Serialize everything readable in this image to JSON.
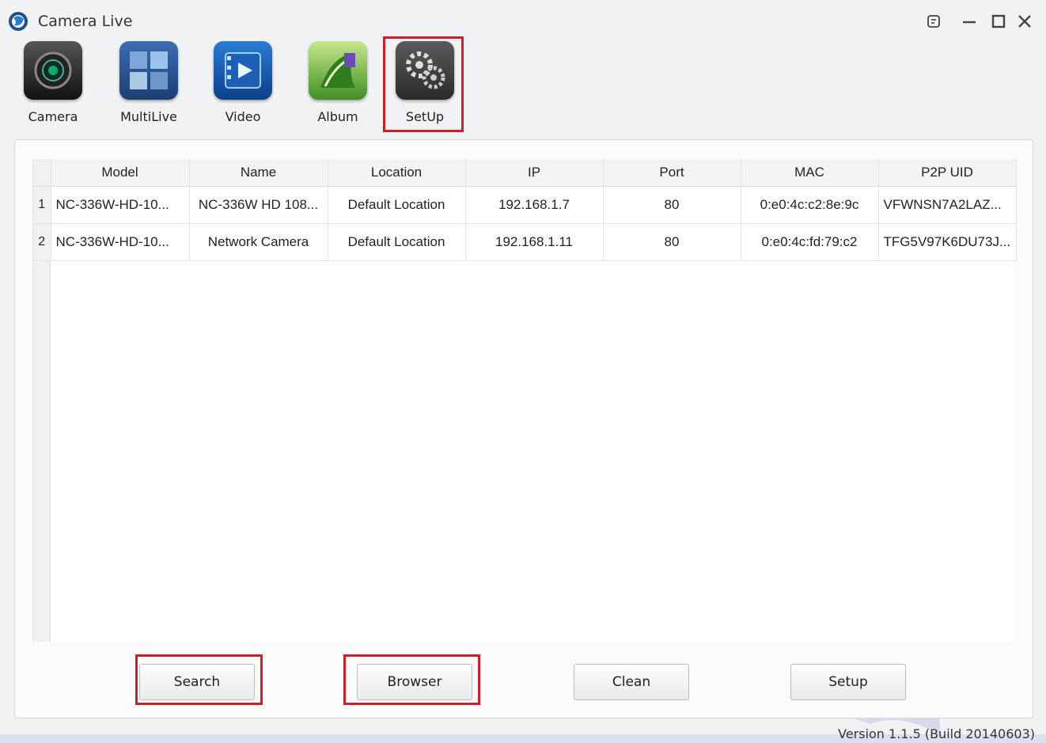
{
  "app": {
    "title": "Camera Live",
    "version": "Version 1.1.5 (Build 20140603)"
  },
  "toolbar": {
    "items": [
      {
        "label": "Camera",
        "icon": "camera-icon"
      },
      {
        "label": "MultiLive",
        "icon": "multilive-icon"
      },
      {
        "label": "Video",
        "icon": "video-icon"
      },
      {
        "label": "Album",
        "icon": "album-icon"
      },
      {
        "label": "SetUp",
        "icon": "gear-icon"
      }
    ]
  },
  "table": {
    "columns": [
      "Model",
      "Name",
      "Location",
      "IP",
      "Port",
      "MAC",
      "P2P UID"
    ],
    "rows": [
      {
        "index": "1",
        "model": "NC-336W-HD-10...",
        "name": "NC-336W HD 108...",
        "location": "Default Location",
        "ip": "192.168.1.7",
        "port": "80",
        "mac": "0:e0:4c:c2:8e:9c",
        "uid": "VFWNSN7A2LAZ..."
      },
      {
        "index": "2",
        "model": "NC-336W-HD-10...",
        "name": "Network Camera",
        "location": "Default Location",
        "ip": "192.168.1.11",
        "port": "80",
        "mac": "0:e0:4c:fd:79:c2",
        "uid": "TFG5V97K6DU73J..."
      }
    ]
  },
  "buttons": {
    "search": "Search",
    "browser": "Browser",
    "clean": "Clean",
    "setup": "Setup"
  },
  "colors": {
    "highlight": "#d11f2a",
    "watermark": "#c9d2e6"
  }
}
